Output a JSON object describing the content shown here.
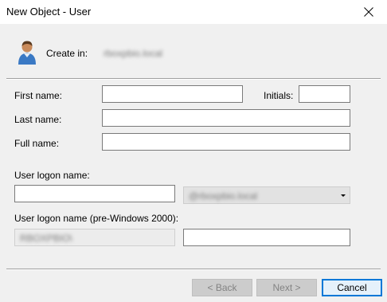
{
  "window": {
    "title": "New Object - User",
    "close_icon": "close-icon"
  },
  "header": {
    "icon": "user-icon",
    "create_in_label": "Create in:",
    "create_in_value": "rboxpbio.local"
  },
  "fields": {
    "first_name_label": "First name:",
    "first_name_value": "",
    "initials_label": "Initials:",
    "initials_value": "",
    "last_name_label": "Last name:",
    "last_name_value": "",
    "full_name_label": "Full name:",
    "full_name_value": "",
    "logon_name_label": "User logon name:",
    "logon_name_value": "",
    "domain_selected": "@rboxpbio.local",
    "pre2000_label": "User logon name (pre-Windows 2000):",
    "pre2000_domain": "RBOXPBIO\\",
    "pre2000_value": ""
  },
  "buttons": {
    "back": "< Back",
    "next": "Next >",
    "cancel": "Cancel"
  }
}
